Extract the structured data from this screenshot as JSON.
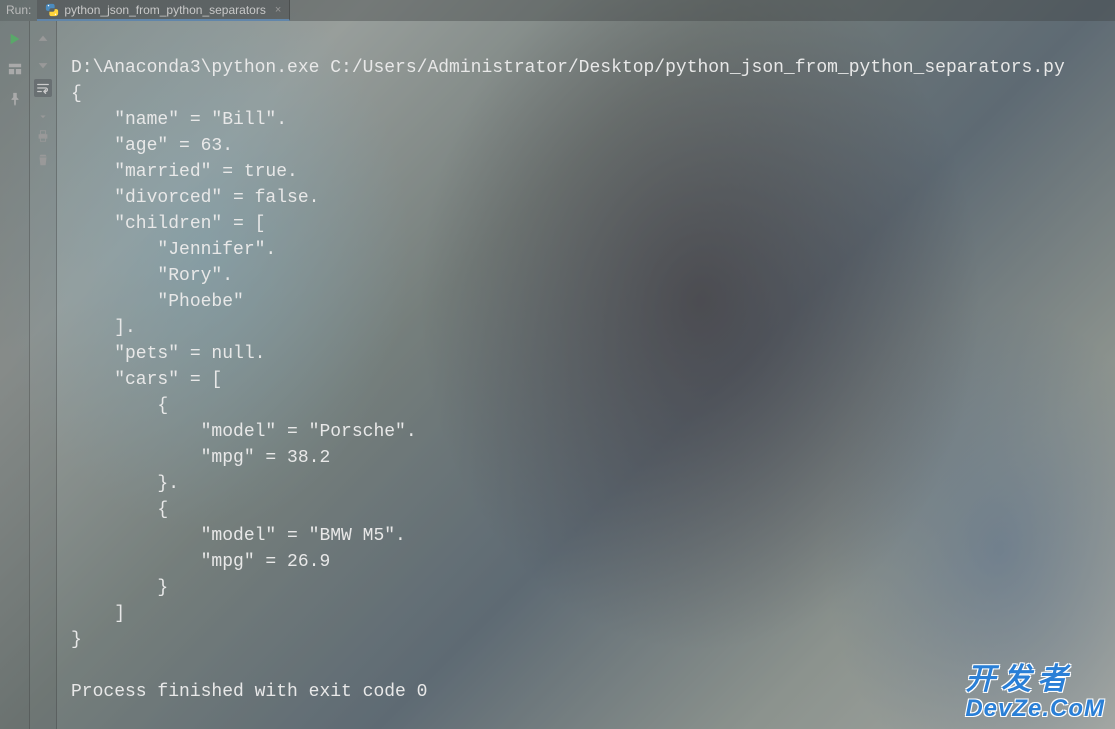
{
  "topbar": {
    "run_label": "Run:",
    "tab": {
      "label": "python_json_from_python_separators",
      "close": "×"
    }
  },
  "console": {
    "command": "D:\\Anaconda3\\python.exe C:/Users/Administrator/Desktop/python_json_from_python_separators.py",
    "output_lines": [
      "{",
      "    \"name\" = \"Bill\".",
      "    \"age\" = 63.",
      "    \"married\" = true.",
      "    \"divorced\" = false.",
      "    \"children\" = [",
      "        \"Jennifer\".",
      "        \"Rory\".",
      "        \"Phoebe\"",
      "    ].",
      "    \"pets\" = null.",
      "    \"cars\" = [",
      "        {",
      "            \"model\" = \"Porsche\".",
      "            \"mpg\" = 38.2",
      "        }.",
      "        {",
      "            \"model\" = \"BMW M5\".",
      "            \"mpg\" = 26.9",
      "        }",
      "    ]",
      "}"
    ],
    "process_line": "Process finished with exit code 0"
  },
  "watermark": {
    "line1": "开发者",
    "line2": "DevZe.CoM"
  },
  "icons": {
    "play": "play-icon",
    "layout": "layout-icon",
    "pin": "pin-icon",
    "up": "arrow-up-icon",
    "down": "arrow-down-icon",
    "wrap": "wrap-icon",
    "scroll": "scroll-icon",
    "print": "print-icon",
    "trash": "trash-icon"
  }
}
